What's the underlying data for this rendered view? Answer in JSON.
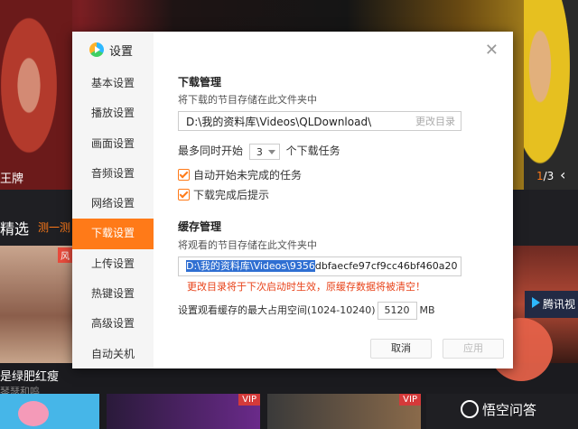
{
  "background": {
    "hero_text": "王牌",
    "pager_current": "1",
    "pager_total": "/3",
    "section_title": "精选",
    "section_tag": "测一测",
    "thumb1_tag": "风",
    "thumb1_title": "是绿肥红瘦",
    "thumb1_sub": "琴瑟和鸣",
    "vip_label": "VIP",
    "ad_label": "腾讯视",
    "watermark": "悟空问答"
  },
  "dialog": {
    "title": "设置",
    "close_icon": "close-icon",
    "nav": [
      {
        "label": "基本设置"
      },
      {
        "label": "播放设置"
      },
      {
        "label": "画面设置"
      },
      {
        "label": "音频设置"
      },
      {
        "label": "网络设置"
      },
      {
        "label": "下载设置",
        "active": true
      },
      {
        "label": "上传设置"
      },
      {
        "label": "热键设置"
      },
      {
        "label": "高级设置"
      },
      {
        "label": "自动关机"
      }
    ],
    "download": {
      "heading": "下载管理",
      "desc": "将下载的节目存储在此文件夹中",
      "path": "D:\\我的资料库\\Videos\\QLDownload\\",
      "change_dir": "更改目录",
      "max_prefix": "最多同时开始",
      "max_value": "3",
      "max_suffix": "个下载任务",
      "auto_start": "自动开始未完成的任务",
      "notify_done": "下载完成后提示"
    },
    "cache": {
      "heading": "缓存管理",
      "desc": "将观看的节目存储在此文件夹中",
      "path_selected": "D:\\我的资料库\\Videos\\9356",
      "path_rest": "dbfaecfe97cf9cc46bf460a20",
      "warning": "更改目录将于下次启动时生效，原缓存数据将被清空！",
      "size_label": "设置观看缓存的最大占用空间(1024-10240)",
      "size_value": "5120",
      "size_unit": "MB"
    },
    "buttons": {
      "cancel": "取消",
      "apply": "应用"
    }
  },
  "colors": {
    "accent": "#ff7a18",
    "selection": "#2f6fd2",
    "warning": "#e8431a"
  }
}
